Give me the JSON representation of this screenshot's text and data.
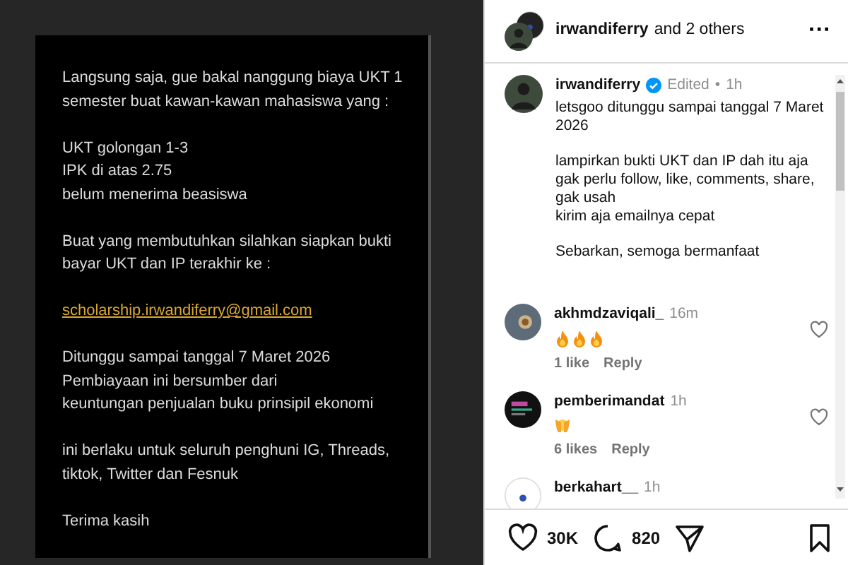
{
  "post_image": {
    "paragraphs": [
      {
        "kind": "text",
        "lines": [
          "Langsung saja, gue bakal nanggung biaya UKT 1 semester buat kawan-kawan mahasiswa yang :"
        ]
      },
      {
        "kind": "text",
        "lines": [
          "UKT golongan 1-3",
          "IPK di atas 2.75",
          "belum menerima beasiswa"
        ]
      },
      {
        "kind": "text",
        "lines": [
          "Buat yang membutuhkan silahkan siapkan bukti bayar UKT dan IP terakhir ke :"
        ]
      },
      {
        "kind": "link",
        "lines": [
          "scholarship.irwandiferry@gmail.com"
        ]
      },
      {
        "kind": "text",
        "lines": [
          "Ditunggu sampai tanggal 7 Maret 2026",
          "Pembiayaan ini bersumber dari",
          "keuntungan penjualan buku prinsipil ekonomi"
        ]
      },
      {
        "kind": "text",
        "lines": [
          "ini berlaku untuk seluruh penghuni IG, Threads, tiktok, Twitter dan Fesnuk"
        ]
      },
      {
        "kind": "text",
        "lines": [
          "Terima kasih"
        ]
      }
    ]
  },
  "header": {
    "username": "irwandiferry",
    "others": "and 2 others",
    "more": "···"
  },
  "caption": {
    "username": "irwandiferry",
    "verified": true,
    "edited": "Edited",
    "dot": "•",
    "time": "1h",
    "paragraphs": [
      [
        "letsgoo ditunggu sampai tanggal 7 Maret 2026"
      ],
      [
        "lampirkan bukti UKT dan IP dah itu aja gak perlu follow, like, comments, share, gak usah",
        "kirim aja emailnya cepat"
      ],
      [
        "Sebarkan, semoga bermanfaat"
      ]
    ]
  },
  "comments": [
    {
      "username": "akhmdzaviqali_",
      "time": "16m",
      "avatar": {
        "kind": "photo"
      },
      "emojis": [
        {
          "kind": "fire"
        },
        {
          "kind": "fire"
        },
        {
          "kind": "fire"
        }
      ],
      "likes": "1 like",
      "reply": "Reply",
      "liked": false
    },
    {
      "username": "pemberimandat",
      "time": "1h",
      "avatar": {
        "kind": "dark"
      },
      "emojis": [
        {
          "kind": "hands"
        }
      ],
      "likes": "6 likes",
      "reply": "Reply",
      "liked": false
    },
    {
      "username": "berkahart__",
      "time": "1h",
      "avatar": {
        "kind": "light"
      }
    }
  ],
  "actions": {
    "likes": "30K",
    "comments": "820",
    "liked": false,
    "saved": false
  }
}
